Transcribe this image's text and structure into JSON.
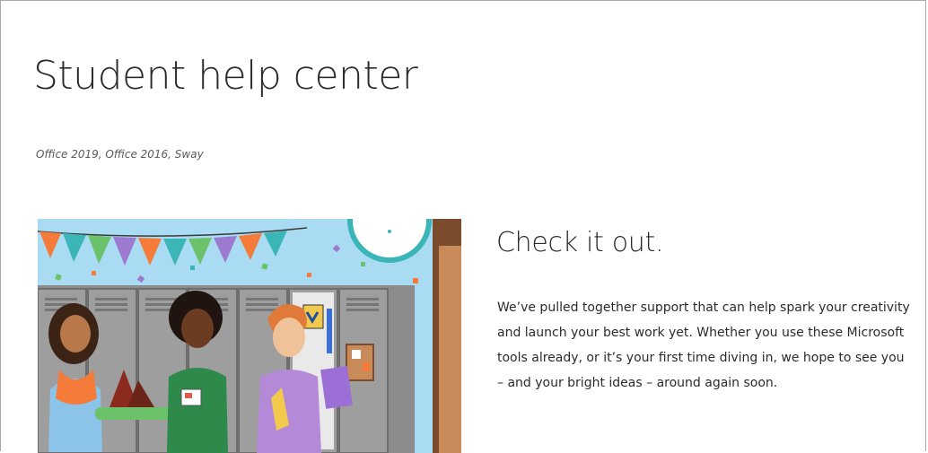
{
  "page": {
    "title": "Student help center",
    "subtitle": "Office 2019, Office 2016, Sway"
  },
  "feature": {
    "heading": "Check it out.",
    "body": "We’ve pulled together support that can help spark your creativity and launch your best work yet. Whether you use these Microsoft tools already, or it’s your first time diving in, we hope to see you – and your bright ideas – around again soon."
  },
  "illustration": {
    "icon": "students-at-lockers-illustration",
    "colors": {
      "sky": "#a9dcf2",
      "locker": "#8c8c8c",
      "locker_light": "#b5b5b5",
      "pennant_teal": "#3cb5b8",
      "pennant_orange": "#f47b3a",
      "pennant_purple": "#9c7ad0",
      "pennant_green": "#6cc26a"
    }
  }
}
